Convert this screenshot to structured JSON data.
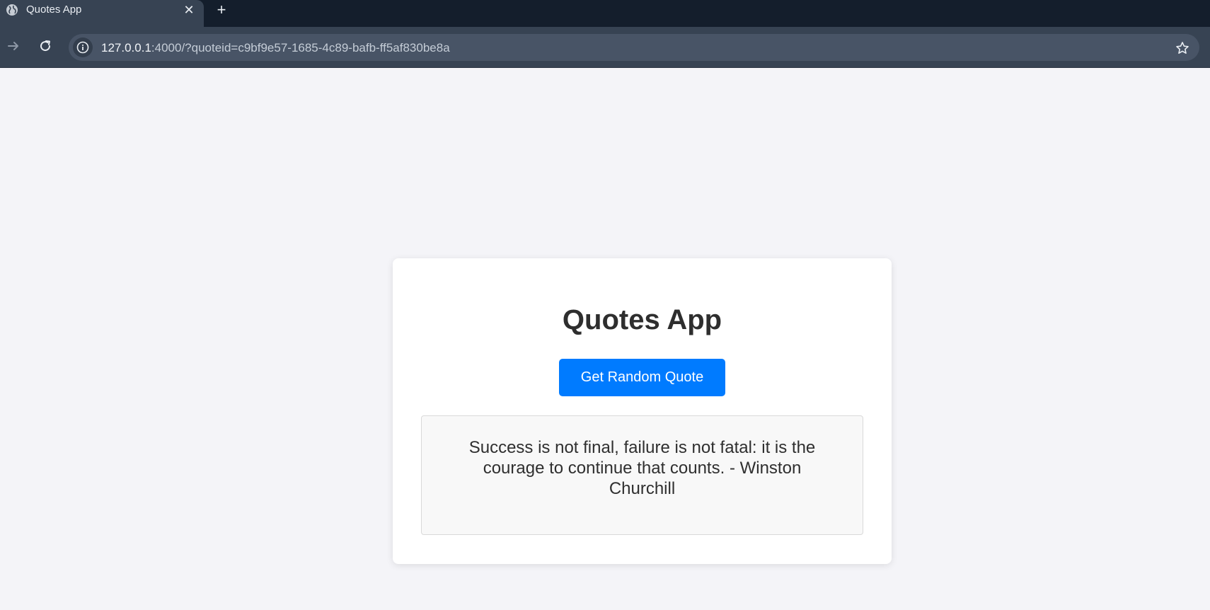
{
  "browser": {
    "tab": {
      "title": "Quotes App",
      "favicon": "globe-icon",
      "close_symbol": "✕"
    },
    "new_tab_symbol": "+",
    "url": {
      "host": "127.0.0.1",
      "rest": ":4000/?quoteid=c9bf9e57-1685-4c89-bafb-ff5af830be8a"
    }
  },
  "app": {
    "title": "Quotes App",
    "button_label": "Get Random Quote",
    "quote": "Success is not final, failure is not fatal: it is the courage to continue that counts. - Winston Churchill"
  },
  "colors": {
    "accent": "#007bff",
    "tabstrip": "#141e2c",
    "toolbar": "#374353",
    "page_bg": "#f4f4f8"
  }
}
